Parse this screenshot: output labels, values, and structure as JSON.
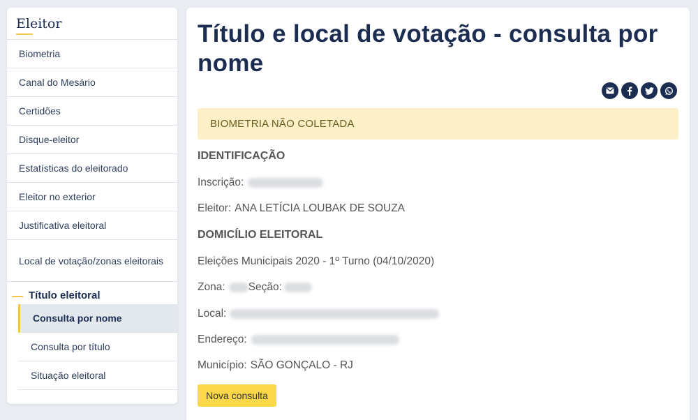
{
  "sidebar": {
    "title": "Eleitor",
    "items": [
      {
        "label": "Biometria"
      },
      {
        "label": "Canal do Mesário"
      },
      {
        "label": "Certidões"
      },
      {
        "label": "Disque-eleitor"
      },
      {
        "label": "Estatísticas do eleitorado"
      },
      {
        "label": "Eleitor no exterior"
      },
      {
        "label": "Justificativa eleitoral"
      },
      {
        "label": "Local de votação/zonas eleitorais"
      }
    ],
    "section": {
      "label": "Título eleitoral",
      "subitems": [
        {
          "label": "Consulta por nome",
          "active": true
        },
        {
          "label": "Consulta por título"
        },
        {
          "label": "Situação eleitoral"
        }
      ]
    }
  },
  "main": {
    "title": "Título e local de votação - consulta por nome",
    "share_icons": [
      "envelope-icon",
      "facebook-icon",
      "twitter-icon",
      "whatsapp-icon"
    ],
    "alert": "BIOMETRIA NÃO COLETADA",
    "identificacao": {
      "heading": "IDENTIFICAÇÃO",
      "inscricao_label": "Inscrição:",
      "eleitor_label": "Eleitor:",
      "eleitor_value": "ANA LETÍCIA LOUBAK DE SOUZA"
    },
    "domicilio": {
      "heading": "DOMICÍLIO ELEITORAL",
      "eleicao": "Eleições Municipais 2020 - 1º Turno (04/10/2020)",
      "zona_label": "Zona:",
      "secao_label": "Seção:",
      "local_label": "Local:",
      "endereco_label": "Endereço:",
      "municipio_label": "Município:",
      "municipio_value": "SÃO GONÇALO - RJ"
    },
    "button": "Nova consulta"
  },
  "colors": {
    "navy": "#1c2d52",
    "accent_yellow": "#f4c542",
    "alert_bg": "#fdf0c8",
    "button_bg": "#fbd74a"
  }
}
